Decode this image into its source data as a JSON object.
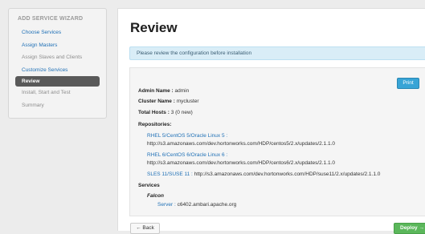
{
  "wizard": {
    "title": "ADD SERVICE WIZARD",
    "steps": [
      {
        "label": "Choose Services"
      },
      {
        "label": "Assign Masters"
      },
      {
        "label": "Assign Slaves and Clients"
      },
      {
        "label": "Customize Services"
      },
      {
        "label": "Review"
      },
      {
        "label": "Install, Start and Test"
      },
      {
        "label": "Summary"
      }
    ]
  },
  "page": {
    "title": "Review",
    "alert": "Please review the configuration before installation",
    "print_label": "Print"
  },
  "review": {
    "admin_label": "Admin Name :",
    "admin_value": "admin",
    "cluster_label": "Cluster Name :",
    "cluster_value": "mycluster",
    "hosts_label": "Total Hosts :",
    "hosts_value": "3 (0 new)",
    "repos_label": "Repositories:",
    "repos": [
      {
        "os": "RHEL 5/CentOS 5/Oracle Linux 5 :",
        "url": "http://s3.amazonaws.com/dev.hortonworks.com/HDP/centos5/2.x/updates/2.1.1.0"
      },
      {
        "os": "RHEL 6/CentOS 6/Oracle Linux 6 :",
        "url": "http://s3.amazonaws.com/dev.hortonworks.com/HDP/centos6/2.x/updates/2.1.1.0"
      },
      {
        "os": "SLES 11/SUSE 11 :",
        "url": "http://s3.amazonaws.com/dev.hortonworks.com/HDP/suse11/2.x/updates/2.1.1.0"
      }
    ],
    "services_label": "Services",
    "services": [
      {
        "name": "Falcon",
        "component_label": "Server :",
        "component_value": "c6402.ambari.apache.org"
      }
    ]
  },
  "footer": {
    "back_label": "← Back",
    "deploy_label": "Deploy →"
  },
  "colors": {
    "link": "#1f70b6",
    "active_step": "#595959",
    "print_button": "#38a4d6",
    "deploy_button": "#5bb75b",
    "alert_bg": "#d9edf7"
  }
}
